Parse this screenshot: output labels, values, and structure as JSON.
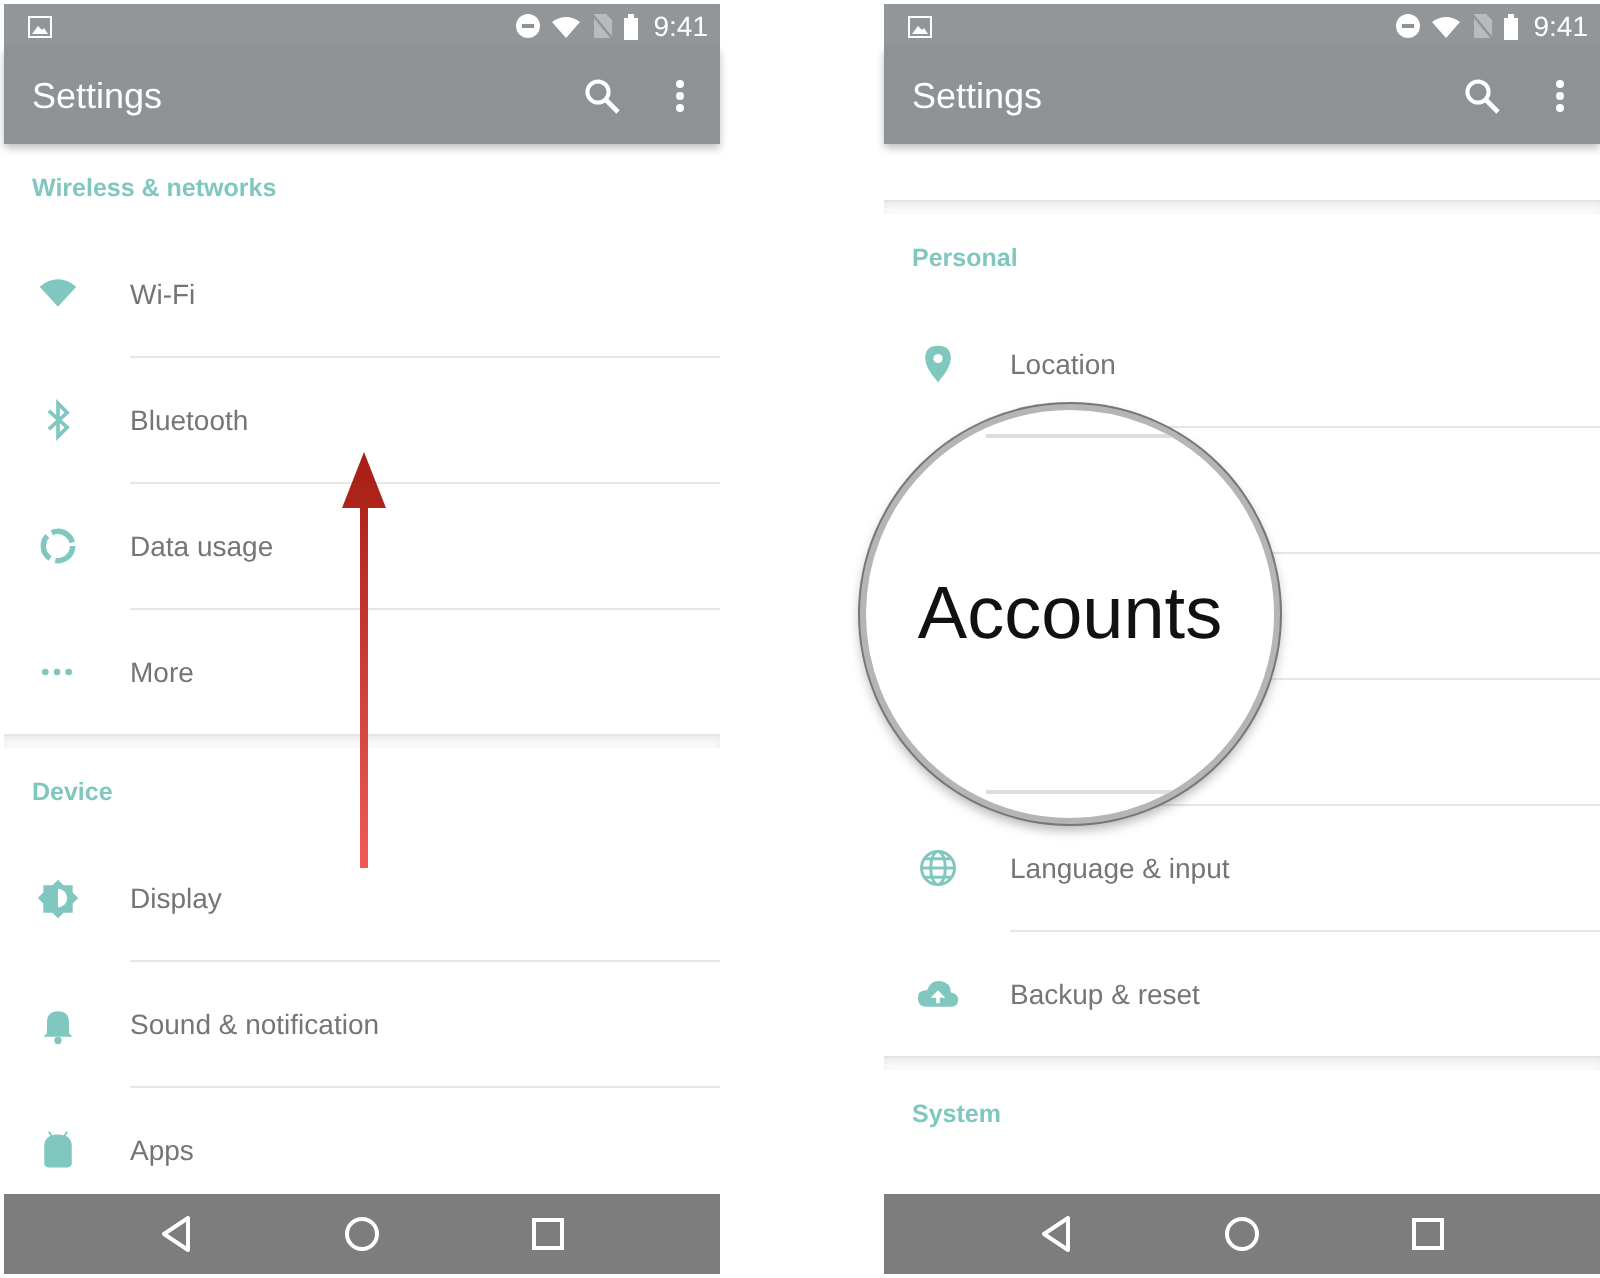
{
  "screens": [
    {
      "status_bar": {
        "time": "9:41"
      },
      "app_bar": {
        "title": "Settings"
      },
      "sections": [
        {
          "header": "Wireless & networks",
          "items": [
            {
              "kind": "row",
              "label": "Wi-Fi"
            },
            {
              "kind": "row",
              "label": "Bluetooth"
            },
            {
              "kind": "row",
              "label": "Data usage"
            },
            {
              "kind": "row",
              "label": "More"
            }
          ]
        },
        {
          "header": "Device",
          "items": [
            {
              "kind": "row",
              "label": "Display"
            },
            {
              "kind": "row",
              "label": "Sound & notification"
            },
            {
              "kind": "row",
              "label": "Apps"
            }
          ]
        }
      ]
    },
    {
      "status_bar": {
        "time": "9:41"
      },
      "app_bar": {
        "title": "Settings"
      },
      "magnifier": {
        "text": "Accounts"
      },
      "sections": [
        {
          "items": [
            {
              "kind": "covered"
            }
          ]
        },
        {
          "header": "Personal",
          "items": [
            {
              "kind": "row",
              "label": "Location"
            },
            {
              "kind": "covered"
            },
            {
              "kind": "covered"
            },
            {
              "kind": "covered"
            },
            {
              "kind": "row",
              "label": "Language & input"
            },
            {
              "kind": "row",
              "label": "Backup & reset"
            }
          ]
        },
        {
          "header": "System"
        }
      ]
    }
  ]
}
